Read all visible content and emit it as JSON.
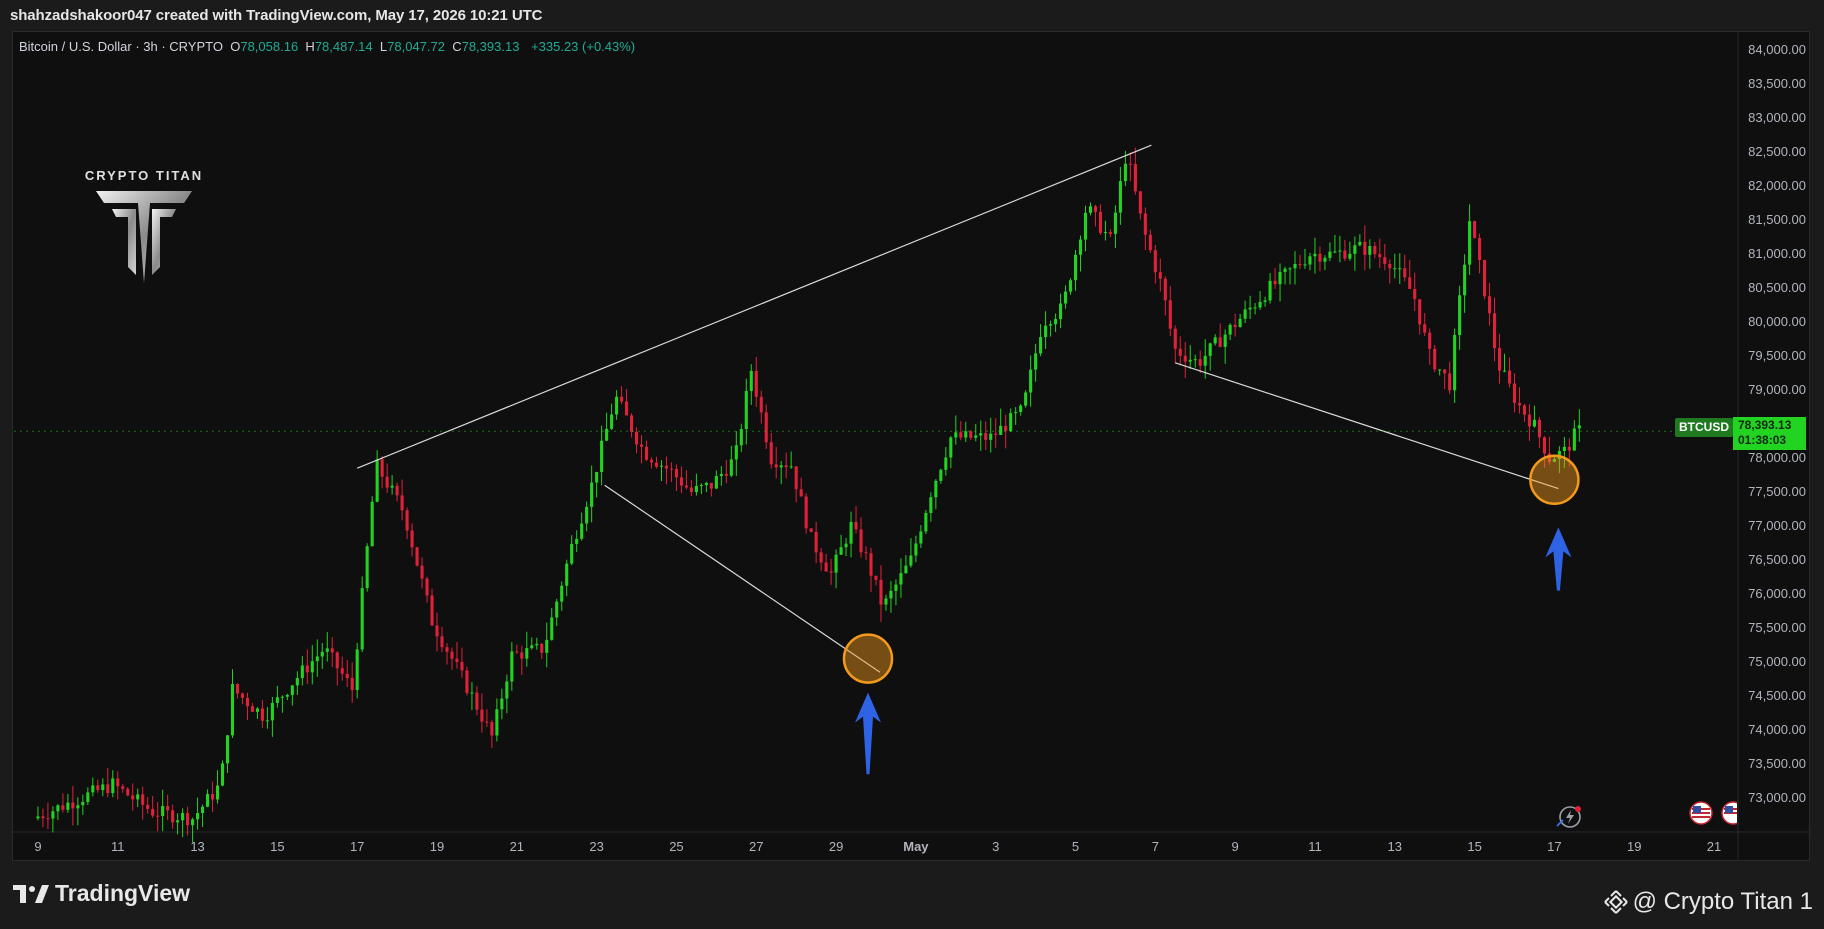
{
  "attribution": "shahzadshakoor047 created with TradingView.com, May 17, 2026 10:21 UTC",
  "legend": {
    "symbol": "Bitcoin / U.S. Dollar · 3h · CRYPTO",
    "open_label": "O",
    "open": "78,058.16",
    "high_label": "H",
    "high": "78,487.14",
    "low_label": "L",
    "low": "78,047.72",
    "close_label": "C",
    "close": "78,393.13",
    "change": "+335.23 (+0.43%)"
  },
  "brand": {
    "name": "CRYPTO TITAN"
  },
  "price_tag": {
    "symbol": "BTCUSD",
    "price": "78,393.13",
    "countdown": "01:38:03"
  },
  "footer": {
    "logo_text": "TradingView",
    "credit": "@ Crypto Titan 1"
  },
  "colors": {
    "up": "#22d322",
    "down": "#e0213a",
    "trendline": "#d9d9d9",
    "circle": "#f39a1d",
    "arrow": "#2f63e6",
    "background": "#0f0f10"
  },
  "icons": [
    "tradingview-logo-icon",
    "binance-logo-icon",
    "lightning-replay-icon",
    "us-flag-icon"
  ],
  "chart_data": {
    "type": "candlestick",
    "ylim": [
      72500,
      84250
    ],
    "y_ticks": [
      "84,000.00",
      "83,500.00",
      "83,000.00",
      "82,500.00",
      "82,000.00",
      "81,500.00",
      "81,000.00",
      "80,500.00",
      "80,000.00",
      "79,500.00",
      "79,000.00",
      "78,500.00",
      "78,000.00",
      "77,500.00",
      "77,000.00",
      "76,500.00",
      "76,000.00",
      "75,500.00",
      "75,000.00",
      "74,500.00",
      "74,000.00",
      "73,500.00",
      "73,000.00"
    ],
    "x_ticks": [
      "9",
      "11",
      "13",
      "15",
      "17",
      "19",
      "21",
      "23",
      "25",
      "27",
      "29",
      "May",
      "3",
      "5",
      "7",
      "9",
      "11",
      "13",
      "15",
      "17",
      "19",
      "21"
    ],
    "x_tick_index": [
      0,
      2,
      4,
      6,
      8,
      10,
      12,
      14,
      16,
      18,
      20,
      22,
      24,
      26,
      28,
      30,
      32,
      34,
      36,
      38,
      40,
      42
    ],
    "x_range_index": [
      -0.6,
      42.3
    ],
    "ohlc_anchors": [
      [
        0,
        72700
      ],
      [
        2,
        73200
      ],
      [
        3,
        72800
      ],
      [
        4,
        72700
      ],
      [
        4.7,
        73200
      ],
      [
        5,
        74600
      ],
      [
        5.8,
        74200
      ],
      [
        6.5,
        74700
      ],
      [
        7.3,
        75200
      ],
      [
        8,
        74600
      ],
      [
        8.6,
        77900
      ],
      [
        9.3,
        77200
      ],
      [
        10,
        75600
      ],
      [
        11,
        74500
      ],
      [
        11.5,
        73900
      ],
      [
        12,
        75100
      ],
      [
        12.8,
        75200
      ],
      [
        13.5,
        76700
      ],
      [
        14,
        77600
      ],
      [
        14.6,
        78900
      ],
      [
        15.3,
        78100
      ],
      [
        16,
        77800
      ],
      [
        16.5,
        77500
      ],
      [
        17,
        77600
      ],
      [
        17.6,
        78000
      ],
      [
        18,
        79300
      ],
      [
        18.5,
        78000
      ],
      [
        19,
        77900
      ],
      [
        19.5,
        76800
      ],
      [
        20,
        76300
      ],
      [
        20.5,
        77000
      ],
      [
        20.9,
        76500
      ],
      [
        21.3,
        75800
      ],
      [
        22,
        76500
      ],
      [
        22.5,
        77500
      ],
      [
        23,
        78300
      ],
      [
        24,
        78300
      ],
      [
        24.8,
        78700
      ],
      [
        25.3,
        80000
      ],
      [
        25.8,
        80200
      ],
      [
        26.4,
        81700
      ],
      [
        27,
        81200
      ],
      [
        27.4,
        82500
      ],
      [
        27.8,
        81400
      ],
      [
        28.3,
        80500
      ],
      [
        28.6,
        79600
      ],
      [
        29.2,
        79400
      ],
      [
        30,
        79900
      ],
      [
        31,
        80500
      ],
      [
        32,
        81000
      ],
      [
        32.6,
        81000
      ],
      [
        33.3,
        81100
      ],
      [
        34,
        80900
      ],
      [
        34.6,
        80400
      ],
      [
        35,
        79500
      ],
      [
        35.5,
        79100
      ],
      [
        36,
        81500
      ],
      [
        36.4,
        80400
      ],
      [
        36.7,
        79400
      ],
      [
        37.2,
        78800
      ],
      [
        37.6,
        78500
      ],
      [
        38,
        78000
      ],
      [
        38.4,
        78100
      ],
      [
        38.7,
        78400
      ]
    ],
    "trendlines": [
      {
        "x": [
          8.0,
          27.9
        ],
        "y": [
          77850,
          82600
        ]
      },
      {
        "x": [
          14.2,
          21.1
        ],
        "y": [
          77600,
          74850
        ]
      },
      {
        "x": [
          28.5,
          38.1
        ],
        "y": [
          79400,
          77550
        ]
      }
    ],
    "annotations": {
      "circles": [
        {
          "x": 20.8,
          "y": 75050
        },
        {
          "x": 38.0,
          "y": 77680
        }
      ],
      "arrows": [
        {
          "x": 20.8,
          "y_tip": 74550,
          "y_tail": 73350
        },
        {
          "x": 38.1,
          "y_tip": 76980,
          "y_tail": 76050
        }
      ]
    }
  }
}
